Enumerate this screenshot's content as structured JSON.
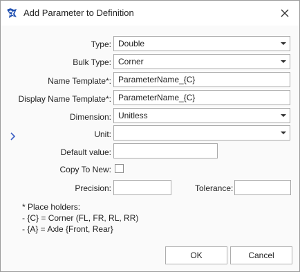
{
  "window": {
    "title": "Add Parameter to Definition",
    "app_icon": "app-logo-icon",
    "close_icon": "close-icon"
  },
  "form": {
    "type": {
      "label": "Type:",
      "value": "Double"
    },
    "bulk_type": {
      "label": "Bulk Type:",
      "value": "Corner"
    },
    "name_template": {
      "label": "Name Template*:",
      "value": "ParameterName_{C}"
    },
    "display_name_template": {
      "label": "Display Name Template*:",
      "value": "ParameterName_{C}"
    },
    "dimension": {
      "label": "Dimension:",
      "value": "Unitless"
    },
    "unit": {
      "label": "Unit:",
      "value": ""
    },
    "default_value": {
      "label": "Default value:",
      "value": ""
    },
    "copy_to_new": {
      "label": "Copy To New:",
      "checked": false
    },
    "precision": {
      "label": "Precision:",
      "value": ""
    },
    "tolerance": {
      "label": "Tolerance:",
      "value": ""
    }
  },
  "notes": [
    "* Place holders:",
    "- {C} = Corner (FL, FR, RL, RR)",
    "- {A} = Axle {Front, Rear}"
  ],
  "buttons": {
    "ok": "OK",
    "cancel": "Cancel"
  },
  "colors": {
    "border": "#a9a9a9",
    "background": "#fafafa",
    "accent": "#3b5fc4"
  }
}
